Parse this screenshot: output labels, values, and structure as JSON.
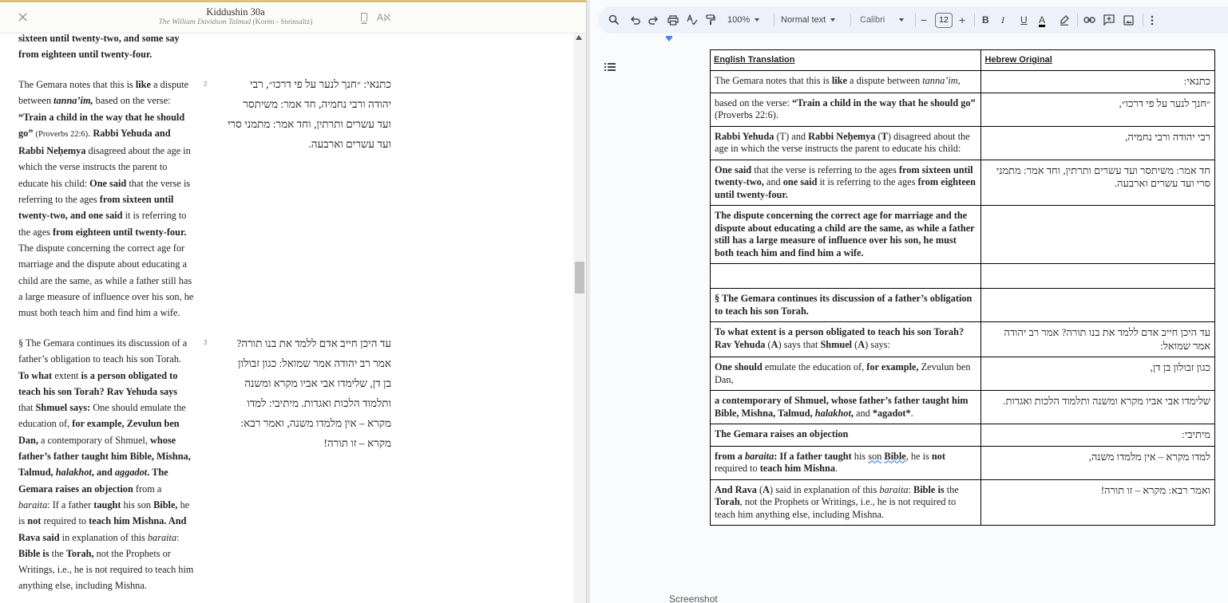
{
  "reader": {
    "title": "Kiddushin 30a",
    "subtitle_italic": "The William Davidson Talmud",
    "subtitle_rest": "(Koren - Steinsaltz)",
    "close_icon": "×",
    "lang_toggle": "Aℵ",
    "segment_2": "2",
    "segment_3": "3",
    "hebrew_2": [
      "כתנאי: ״חנך לנער על פי דרכו״, רבי",
      "יהודה ורבי נחמיה, חד אמר: משיתסר",
      "ועד עשרים ותרתין, וחד אמר: מתמני סרי",
      "ועד עשרים וארבעה."
    ],
    "hebrew_3": [
      "עד היכן חייב אדם ללמד את בנו תורה?",
      "אמר רב יהודה אמר שמואל: כגון זבולון",
      "בן דן, שלימדו אבי אביו מקרא ומשנה",
      "ותלמוד הלכות ואגדות. מיתיבי: למדו",
      "מקרא – אין מלמדו משנה, ואמר רבא:",
      "מקרא – זו תורה!"
    ]
  },
  "doc": {
    "toolbar": {
      "zoom": "100%",
      "style": "Normal text",
      "font": "Calibri",
      "font_size": "12",
      "minus": "−",
      "plus": "+",
      "bold": "B",
      "italic": "I",
      "underline": "U",
      "textcolor": "A"
    },
    "table": {
      "header_en": "English Translation",
      "header_he": "Hebrew Original",
      "rows": [
        {
          "he": "כתנאי:"
        },
        {
          "he": "״חנך לנער על פי דרכו״,"
        },
        {
          "he": "רבי יהודה ורבי נחמיה,"
        },
        {
          "he": "חד אמר: משיתסר ועד עשרים ותרתין, וחד אמר: מתמני סרי ועד עשרים וארבעה."
        },
        {
          "he": ""
        },
        {
          "he": ""
        },
        {
          "he": ""
        },
        {
          "he": "עד היכן חייב אדם ללמד את בנו תורה? אמר רב יהודה אמר שמואל:"
        },
        {
          "he": "כגון זבולון בן דן,"
        },
        {
          "he": "שלימדו אבי אביו מקרא ומשנה ותלמוד הלכות ואגדות."
        },
        {
          "he": "מיתיבי:"
        },
        {
          "he": "למדו מקרא – אין מלמדו משנה,"
        },
        {
          "he": "ואמר רבא: מקרא – זו תורה!"
        }
      ]
    },
    "footer_label": "Screenshot"
  }
}
